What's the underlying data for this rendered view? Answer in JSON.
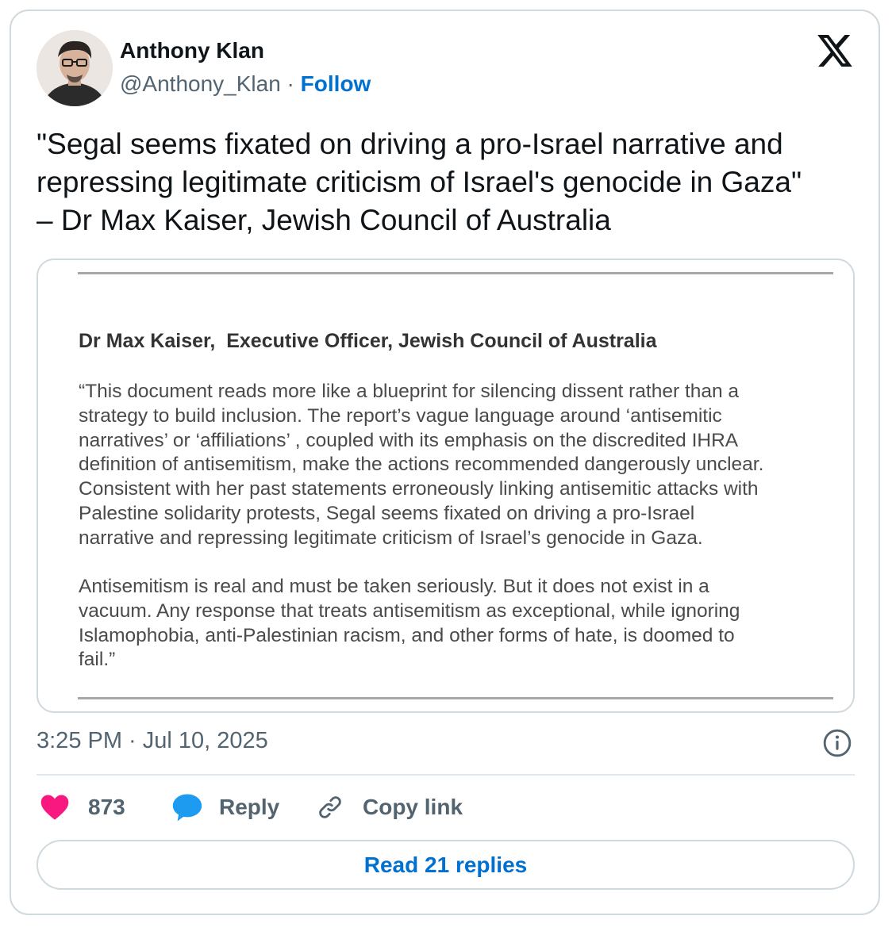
{
  "author": {
    "name": "Anthony Klan",
    "handle": "@Anthony_Klan",
    "separator": " · ",
    "follow_label": "Follow"
  },
  "tweet": {
    "lines": [
      "\"Segal seems fixated on driving a pro-Israel narrative and",
      "repressing legitimate criticism of Israel's genocide in Gaza\"",
      "– Dr Max Kaiser, Jewish Council of Australia"
    ]
  },
  "document": {
    "heading": "Dr Max Kaiser,  Executive Officer, Jewish Council of Australia",
    "paragraph1": [
      "“This document reads more like a blueprint for silencing dissent rather than a",
      "strategy to build inclusion. The report’s vague language around ‘antisemitic",
      "narratives’ or ‘affiliations’ , coupled with its emphasis on the discredited IHRA",
      "definition of antisemitism, make the actions recommended dangerously unclear.",
      "Consistent with her past statements erroneously linking antisemitic attacks with",
      "Palestine solidarity protests, Segal seems fixated on driving a pro-Israel",
      "narrative and repressing legitimate criticism of Israel’s genocide in Gaza."
    ],
    "paragraph2": [
      "Antisemitism is real and must be taken seriously. But it does not exist in a",
      "vacuum. Any response that treats antisemitism as exceptional, while ignoring",
      "Islamophobia, anti-Palestinian racism, and other forms of hate, is doomed to",
      "fail.”"
    ]
  },
  "timestamp": "3:25 PM · Jul 10, 2025",
  "actions": {
    "like_count": "873",
    "reply_label": "Reply",
    "copy_link_label": "Copy link"
  },
  "read_replies_label": "Read 21 replies",
  "colors": {
    "like": "#f91880",
    "reply": "#1d9bf0",
    "link": "#0070d1",
    "muted": "#536471",
    "border": "#cfd9de"
  },
  "icons": [
    "x-logo-icon",
    "heart-icon",
    "reply-bubble-icon",
    "link-icon",
    "info-icon"
  ]
}
